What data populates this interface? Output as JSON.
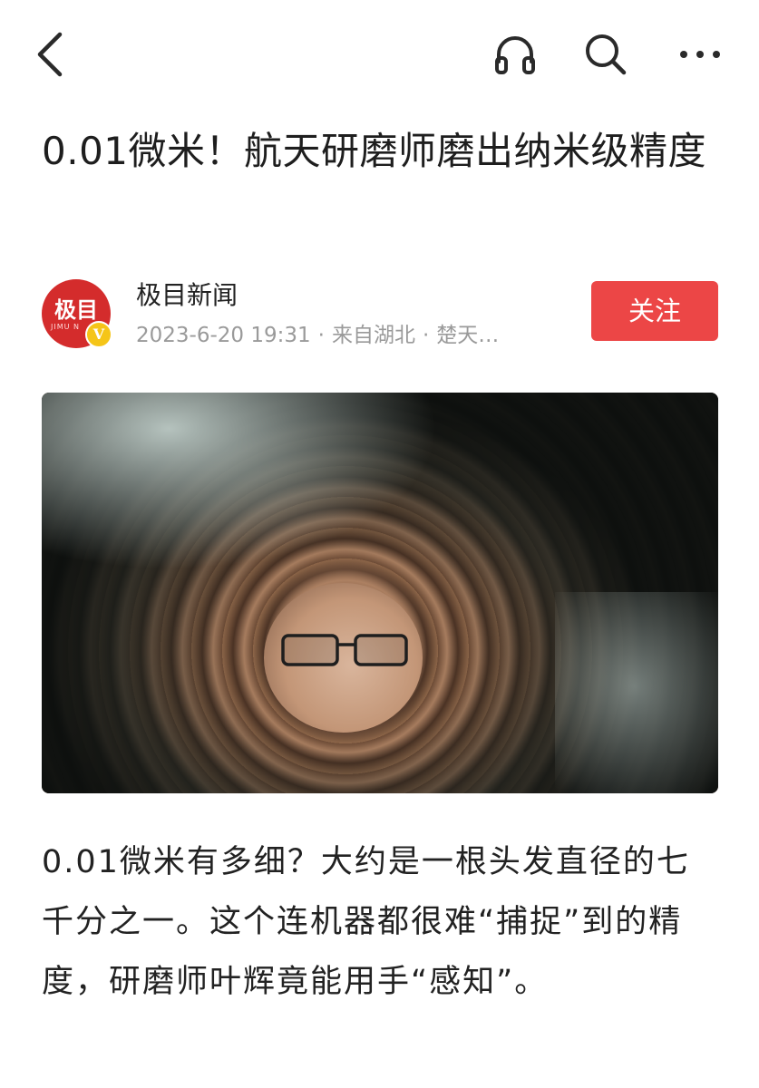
{
  "nav": {
    "back_icon": "chevron-left-icon",
    "listen_icon": "headphones-icon",
    "search_icon": "search-icon",
    "more_icon": "more-dots-icon"
  },
  "article": {
    "title": "0.01微米！航天研磨师磨出纳米级精度",
    "source": {
      "name": "极目新闻",
      "avatar_text": "极目",
      "avatar_subtext": "JIMU N",
      "verified_badge": "V",
      "date": "2023-6-20 19:31",
      "location": "来自湖北",
      "extra": "楚天…",
      "separator": "·"
    },
    "follow_label": "关注",
    "paragraph": "0.01微米有多细？大约是一根头发直径的七千分之一。这个连机器都很难“捕捉”到的精度，研磨师叶辉竟能用手“感知”。"
  },
  "colors": {
    "accent": "#ec4646",
    "avatar_bg": "#d42c2c",
    "meta_text": "#9a9a9a",
    "badge": "#f5c518"
  }
}
